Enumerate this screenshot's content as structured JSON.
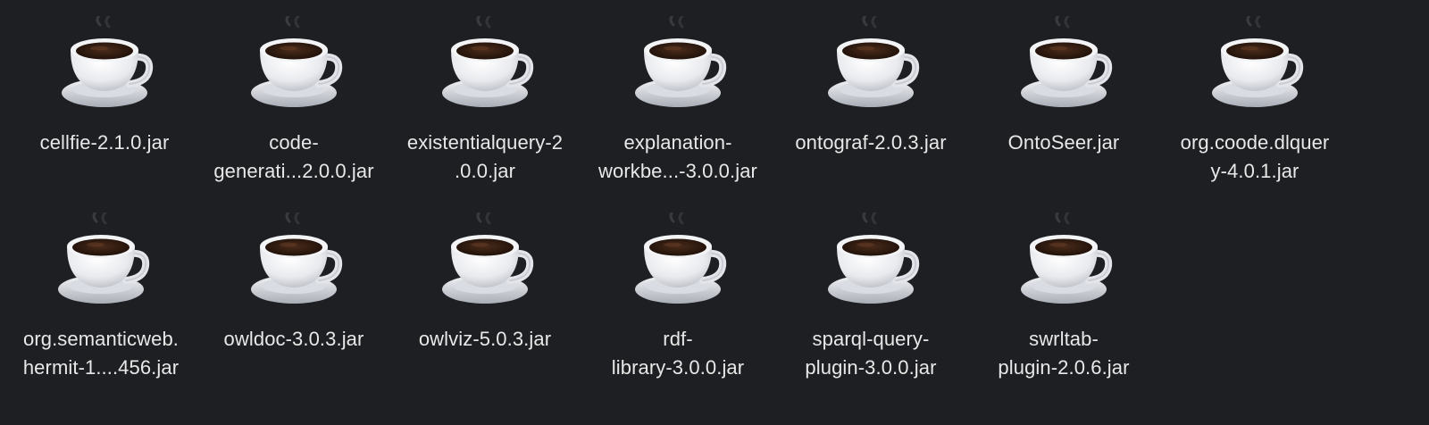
{
  "window": {
    "background": "#1e1f22",
    "label_color": "#e8e8e8",
    "icon": "java-coffee-cup-icon"
  },
  "files": [
    {
      "lines": [
        "cellfie-2.1.0.jar"
      ]
    },
    {
      "lines": [
        "code-",
        "generati...2.0.0.jar"
      ]
    },
    {
      "lines": [
        "existentialquery-2",
        ".0.0.jar"
      ]
    },
    {
      "lines": [
        "explanation-",
        "workbe...-3.0.0.jar"
      ]
    },
    {
      "lines": [
        "ontograf-2.0.3.jar"
      ]
    },
    {
      "lines": [
        "OntoSeer.jar"
      ]
    },
    {
      "lines": [
        "org.coode.dlquer",
        "y-4.0.1.jar"
      ]
    },
    {
      "lines": [
        "org.semanticweb.",
        "hermit-1....456.jar"
      ]
    },
    {
      "lines": [
        "owldoc-3.0.3.jar"
      ]
    },
    {
      "lines": [
        "owlviz-5.0.3.jar"
      ]
    },
    {
      "lines": [
        "rdf-",
        "library-3.0.0.jar"
      ]
    },
    {
      "lines": [
        "sparql-query-",
        "plugin-3.0.0.jar"
      ]
    },
    {
      "lines": [
        "swrltab-",
        "plugin-2.0.6.jar"
      ]
    }
  ]
}
